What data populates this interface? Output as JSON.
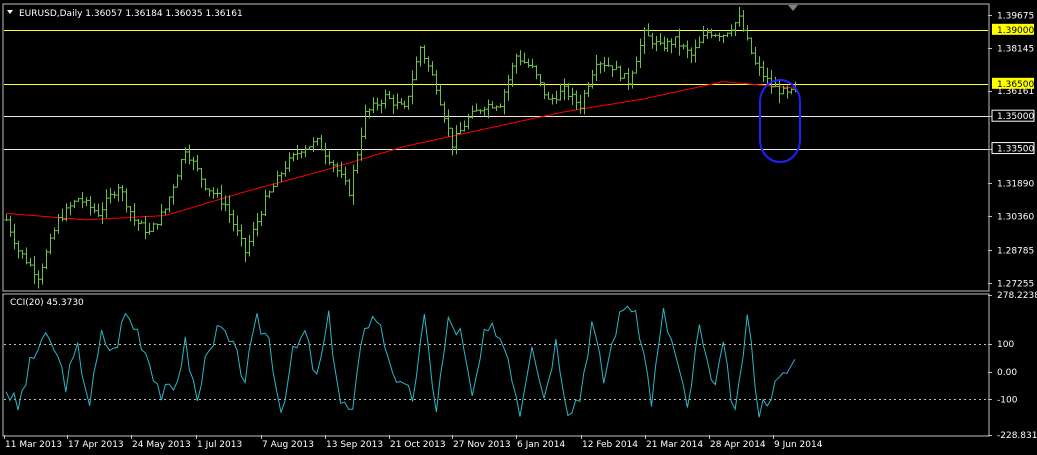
{
  "window": {
    "symbol_header": "EURUSD,Daily  1.36057 1.36184 1.36035 1.36161"
  },
  "colors": {
    "background": "#000000",
    "frame": "#c0c0c0",
    "bar_up": "#6fc04a",
    "ma_line": "#ff0000",
    "cci_line": "#2bb7c6",
    "hline": "#e8e8e8",
    "hline_yellow": "#ffff33",
    "label_yellow_bg": "#ffff00",
    "circle": "#2020ff"
  },
  "chart_data": [
    {
      "type": "ohlc",
      "title": "EURUSD,Daily",
      "ohlc_header": {
        "open": "1.36057",
        "high": "1.36184",
        "low": "1.36035",
        "close": "1.36161"
      },
      "ylim": [
        1.2695,
        1.4015
      ],
      "y_ticks": [
        "1.39675",
        "1.38145",
        "1.36161",
        "1.35000",
        "1.33500",
        "1.31890",
        "1.30360",
        "1.28785",
        "1.27255"
      ],
      "x_ticks": [
        "11 Mar 2013",
        "17 Apr 2013",
        "24 May 2013",
        "1 Jul 2013",
        "7 Aug 2013",
        "13 Sep 2013",
        "21 Oct 2013",
        "27 Nov 2013",
        "6 Jan 2014",
        "12 Feb 2014",
        "21 Mar 2014",
        "28 Apr 2014",
        "9 Jun 2014"
      ],
      "price_shape_x": [
        0,
        3,
        8,
        13,
        18,
        23,
        28,
        32,
        36,
        40,
        45,
        50,
        55,
        60,
        65,
        70,
        74,
        78,
        82,
        86,
        90,
        95,
        100,
        104,
        108,
        112,
        116,
        120,
        124,
        128,
        132,
        136,
        140,
        144,
        148,
        152,
        156,
        160,
        164,
        168,
        172,
        176,
        180,
        184,
        188,
        192,
        196,
        198
      ],
      "price_shape_y": [
        1.302,
        1.288,
        1.276,
        1.302,
        1.312,
        1.305,
        1.318,
        1.302,
        1.296,
        1.307,
        1.335,
        1.318,
        1.309,
        1.287,
        1.311,
        1.327,
        1.335,
        1.338,
        1.328,
        1.315,
        1.351,
        1.359,
        1.353,
        1.382,
        1.364,
        1.337,
        1.349,
        1.355,
        1.356,
        1.378,
        1.372,
        1.357,
        1.362,
        1.355,
        1.376,
        1.373,
        1.366,
        1.388,
        1.382,
        1.385,
        1.378,
        1.389,
        1.388,
        1.395,
        1.374,
        1.364,
        1.36,
        1.3615
      ],
      "moving_average": {
        "x": [
          0,
          20,
          40,
          60,
          80,
          100,
          120,
          140,
          160,
          180,
          198
        ],
        "y": [
          1.305,
          1.302,
          1.304,
          1.315,
          1.325,
          1.336,
          1.344,
          1.352,
          1.358,
          1.366,
          1.363
        ]
      },
      "horizontal_lines": [
        {
          "value": 1.39,
          "label": "1.39000",
          "style": "yellow-label"
        },
        {
          "value": 1.365,
          "label": "1.36500",
          "style": "yellow-label"
        },
        {
          "value": 1.35,
          "label": "1.35000",
          "style": "white-label"
        },
        {
          "value": 1.335,
          "label": "1.33500",
          "style": "white-label"
        }
      ],
      "current_price_label": "1.36161"
    },
    {
      "type": "line",
      "title": "CCI(20) 45.3730",
      "ylim": [
        -228.8311,
        278.2238
      ],
      "y_ticks": [
        "278.2238",
        "100",
        "0.00",
        "-100",
        "-228.8311"
      ],
      "levels": [
        100,
        -100
      ],
      "shape_x": [
        0,
        3,
        6,
        9,
        12,
        15,
        18,
        21,
        24,
        27,
        30,
        33,
        36,
        39,
        42,
        45,
        48,
        51,
        54,
        57,
        60,
        63,
        66,
        69,
        72,
        75,
        78,
        81,
        84,
        87,
        90,
        93,
        96,
        99,
        102,
        105,
        108,
        111,
        114,
        117,
        120,
        123,
        126,
        129,
        132,
        135,
        138,
        141,
        144,
        147,
        150,
        153,
        156,
        159,
        162,
        165,
        168,
        171,
        174,
        177,
        180,
        183,
        186,
        189,
        192,
        195,
        198
      ],
      "shape_y": [
        -60,
        -130,
        20,
        120,
        90,
        -40,
        80,
        -110,
        130,
        70,
        210,
        150,
        40,
        -80,
        -70,
        100,
        -110,
        110,
        150,
        80,
        -20,
        180,
        120,
        -140,
        60,
        140,
        -30,
        190,
        -110,
        -150,
        180,
        200,
        60,
        -60,
        -90,
        180,
        -130,
        180,
        140,
        -100,
        120,
        160,
        60,
        -140,
        120,
        -90,
        110,
        -130,
        -90,
        180,
        -30,
        160,
        260,
        150,
        -100,
        210,
        60,
        -140,
        160,
        -60,
        80,
        -170,
        200,
        -140,
        -70,
        -20,
        45
      ]
    }
  ]
}
